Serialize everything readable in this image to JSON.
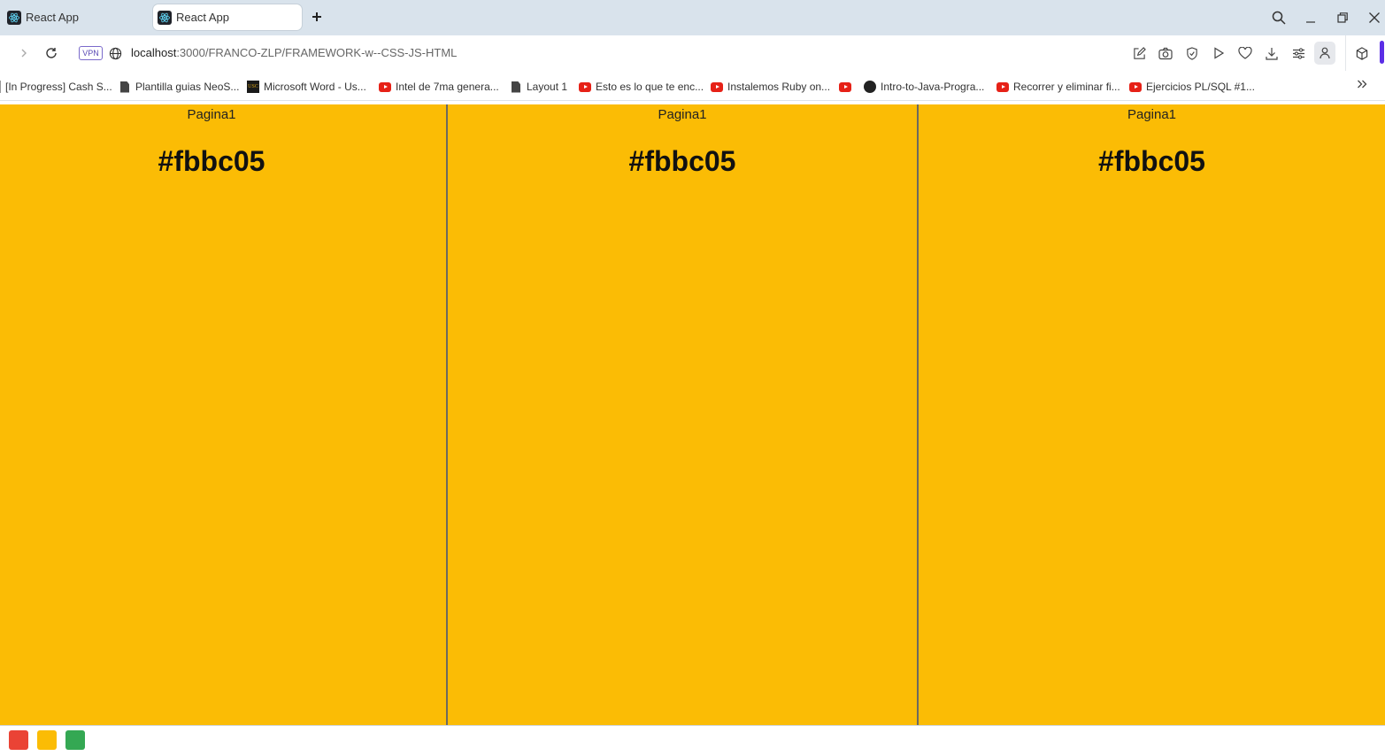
{
  "tabs": [
    {
      "title": "React App",
      "active": false
    },
    {
      "title": "React App",
      "active": true
    }
  ],
  "address_bar": {
    "vpn_label": "VPN",
    "url_host": "localhost",
    "url_path": ":3000/FRANCO-ZLP/FRAMEWORK-w--CSS-JS-HTML"
  },
  "bookmarks": [
    {
      "label": "[In Progress] Cash S...",
      "icon": "none"
    },
    {
      "label": "Plantilla guias NeoS...",
      "icon": "document-icon"
    },
    {
      "label": "Microsoft Word - Us...",
      "icon": "usc-icon"
    },
    {
      "label": "Intel de 7ma genera...",
      "icon": "youtube-icon"
    },
    {
      "label": "Layout 1",
      "icon": "document-icon"
    },
    {
      "label": "Esto es lo que te enc...",
      "icon": "youtube-icon"
    },
    {
      "label": "Instalemos Ruby on...",
      "icon": "youtube-icon"
    },
    {
      "label": "",
      "icon": "youtube-icon"
    },
    {
      "label": "Intro-to-Java-Progra...",
      "icon": "github-icon"
    },
    {
      "label": "Recorrer y eliminar fi...",
      "icon": "youtube-icon"
    },
    {
      "label": "Ejercicios PL/SQL #1...",
      "icon": "youtube-icon"
    }
  ],
  "usc_text": "USC",
  "panels": [
    {
      "title": "Pagina1",
      "color": "#fbbc05"
    },
    {
      "title": "Pagina1",
      "color": "#fbbc05"
    },
    {
      "title": "Pagina1",
      "color": "#fbbc05"
    }
  ],
  "swatches": [
    {
      "name": "red",
      "color": "#ea4335"
    },
    {
      "name": "yellow",
      "color": "#fbbc05"
    },
    {
      "name": "green",
      "color": "#34a853"
    }
  ]
}
